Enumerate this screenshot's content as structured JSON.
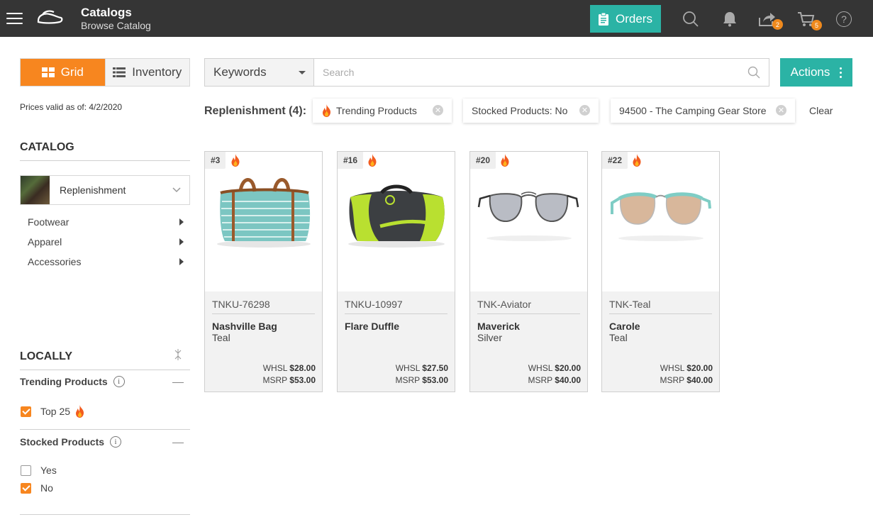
{
  "header": {
    "title": "Catalogs",
    "subtitle": "Browse Catalog",
    "orders_label": "Orders",
    "share_badge": "2",
    "cart_badge": "5",
    "help_glyph": "?"
  },
  "colors": {
    "topbar": "#353535",
    "accent_orange": "#f7861f",
    "accent_teal": "#2bb3a5"
  },
  "view_toggle": {
    "grid_label": "Grid",
    "inventory_label": "Inventory",
    "active": "grid"
  },
  "prices_valid": "Prices valid as of: 4/2/2020",
  "catalog": {
    "heading": "CATALOG",
    "selected": "Replenishment",
    "items": [
      {
        "label": "Footwear"
      },
      {
        "label": "Apparel"
      },
      {
        "label": "Accessories"
      }
    ]
  },
  "locally": {
    "heading": "LOCALLY",
    "trending": {
      "title": "Trending Products",
      "option": "Top 25",
      "checked": true
    },
    "stocked": {
      "title": "Stocked Products",
      "options": [
        {
          "label": "Yes",
          "checked": false
        },
        {
          "label": "No",
          "checked": true
        }
      ]
    }
  },
  "search": {
    "scope": "Keywords",
    "placeholder": "Search",
    "value": ""
  },
  "actions_label": "Actions",
  "filters": {
    "label": "Replenishment (4):",
    "chips": [
      {
        "label": "Trending Products",
        "icon": "flame-icon"
      },
      {
        "label": "Stocked Products: No"
      },
      {
        "label": "94500 - The Camping Gear Store"
      }
    ],
    "clear_label": "Clear"
  },
  "products": [
    {
      "rank": "#3",
      "sku": "TNKU-76298",
      "name": "Nashville Bag",
      "color": "Teal",
      "whsl_label": "WHSL",
      "whsl": "$28.00",
      "msrp_label": "MSRP",
      "msrp": "$53.00"
    },
    {
      "rank": "#16",
      "sku": "TNKU-10997",
      "name": "Flare Duffle",
      "color": "",
      "whsl_label": "WHSL",
      "whsl": "$27.50",
      "msrp_label": "MSRP",
      "msrp": "$53.00"
    },
    {
      "rank": "#20",
      "sku": "TNK-Aviator",
      "name": "Maverick",
      "color": "Silver",
      "whsl_label": "WHSL",
      "whsl": "$20.00",
      "msrp_label": "MSRP",
      "msrp": "$40.00"
    },
    {
      "rank": "#22",
      "sku": "TNK-Teal",
      "name": "Carole",
      "color": "Teal",
      "whsl_label": "WHSL",
      "whsl": "$20.00",
      "msrp_label": "MSRP",
      "msrp": "$40.00"
    }
  ]
}
